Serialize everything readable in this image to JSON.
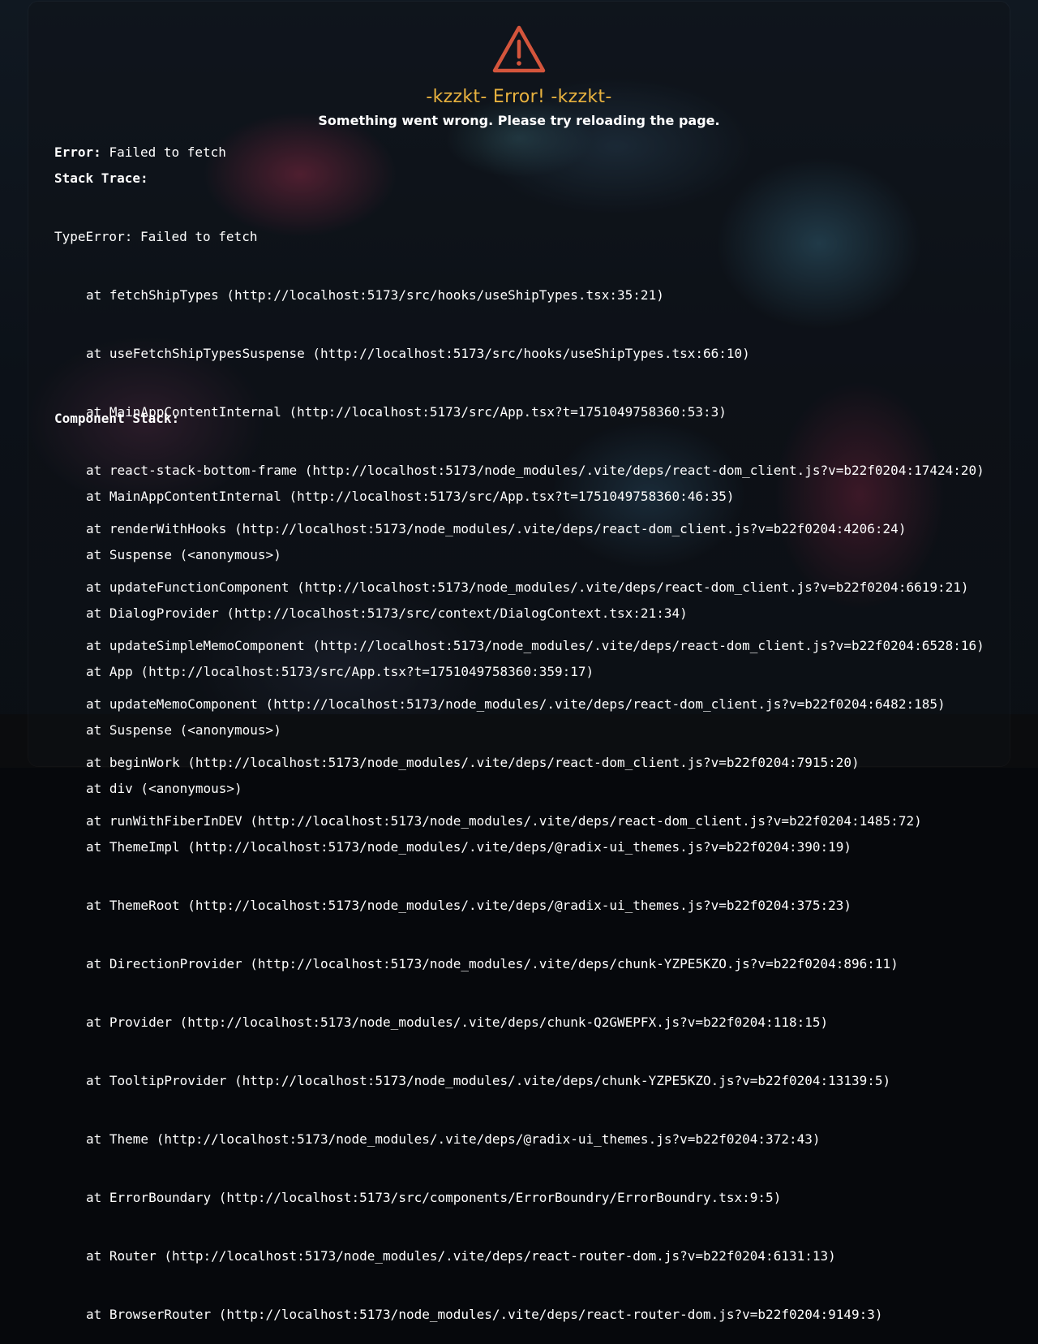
{
  "header": {
    "icon": "warning-triangle-icon",
    "icon_color": "#d4553c",
    "title": "-kzzkt- Error! -kzzkt-",
    "title_color": "#e8b23f",
    "subtitle": "Something went wrong. Please try reloading the page."
  },
  "error": {
    "label": "Error:",
    "message": "Failed to fetch"
  },
  "stack_trace": {
    "label": "Stack Trace:",
    "head": "TypeError: Failed to fetch",
    "lines": [
      "at fetchShipTypes (http://localhost:5173/src/hooks/useShipTypes.tsx:35:21)",
      "at useFetchShipTypesSuspense (http://localhost:5173/src/hooks/useShipTypes.tsx:66:10)",
      "at MainAppContentInternal (http://localhost:5173/src/App.tsx?t=1751049758360:53:3)",
      "at react-stack-bottom-frame (http://localhost:5173/node_modules/.vite/deps/react-dom_client.js?v=b22f0204:17424:20)",
      "at renderWithHooks (http://localhost:5173/node_modules/.vite/deps/react-dom_client.js?v=b22f0204:4206:24)",
      "at updateFunctionComponent (http://localhost:5173/node_modules/.vite/deps/react-dom_client.js?v=b22f0204:6619:21)",
      "at updateSimpleMemoComponent (http://localhost:5173/node_modules/.vite/deps/react-dom_client.js?v=b22f0204:6528:16)",
      "at updateMemoComponent (http://localhost:5173/node_modules/.vite/deps/react-dom_client.js?v=b22f0204:6482:185)",
      "at beginWork (http://localhost:5173/node_modules/.vite/deps/react-dom_client.js?v=b22f0204:7915:20)",
      "at runWithFiberInDEV (http://localhost:5173/node_modules/.vite/deps/react-dom_client.js?v=b22f0204:1485:72)"
    ]
  },
  "component_stack": {
    "label": "Component Stack:",
    "lines": [
      "at MainAppContentInternal (http://localhost:5173/src/App.tsx?t=1751049758360:46:35)",
      "at Suspense (<anonymous>)",
      "at DialogProvider (http://localhost:5173/src/context/DialogContext.tsx:21:34)",
      "at App (http://localhost:5173/src/App.tsx?t=1751049758360:359:17)",
      "at Suspense (<anonymous>)",
      "at div (<anonymous>)",
      "at ThemeImpl (http://localhost:5173/node_modules/.vite/deps/@radix-ui_themes.js?v=b22f0204:390:19)",
      "at ThemeRoot (http://localhost:5173/node_modules/.vite/deps/@radix-ui_themes.js?v=b22f0204:375:23)",
      "at DirectionProvider (http://localhost:5173/node_modules/.vite/deps/chunk-YZPE5KZO.js?v=b22f0204:896:11)",
      "at Provider (http://localhost:5173/node_modules/.vite/deps/chunk-Q2GWEPFX.js?v=b22f0204:118:15)",
      "at TooltipProvider (http://localhost:5173/node_modules/.vite/deps/chunk-YZPE5KZO.js?v=b22f0204:13139:5)",
      "at Theme (http://localhost:5173/node_modules/.vite/deps/@radix-ui_themes.js?v=b22f0204:372:43)",
      "at ErrorBoundary (http://localhost:5173/src/components/ErrorBoundry/ErrorBoundry.tsx:9:5)",
      "at Router (http://localhost:5173/node_modules/.vite/deps/react-router-dom.js?v=b22f0204:6131:13)",
      "at BrowserRouter (http://localhost:5173/node_modules/.vite/deps/react-router-dom.js?v=b22f0204:9149:3)"
    ]
  }
}
